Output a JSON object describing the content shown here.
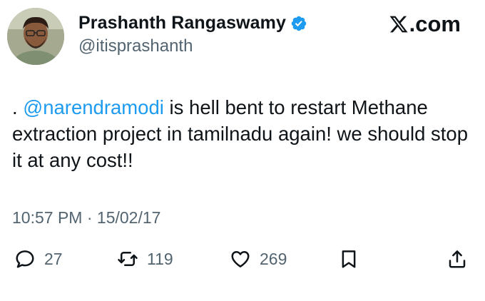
{
  "author": {
    "display_name": "Prashanth Rangaswamy",
    "handle": "@itisprashanth",
    "verified": true,
    "avatar_icon": "person-avatar"
  },
  "brand": {
    "label": ".com",
    "icon": "x-logo-icon"
  },
  "tweet": {
    "prefix": ". ",
    "mention": "@narendramodi",
    "body": " is hell bent to restart Methane extraction project in tamilnadu again! we should stop it at any cost!!"
  },
  "meta": {
    "time": "10:57 PM",
    "separator": " · ",
    "date": "15/02/17"
  },
  "actions": {
    "replies": "27",
    "reposts": "119",
    "likes": "269"
  },
  "colors": {
    "accent": "#1d9bf0",
    "muted": "#536471",
    "text": "#0f1419"
  }
}
